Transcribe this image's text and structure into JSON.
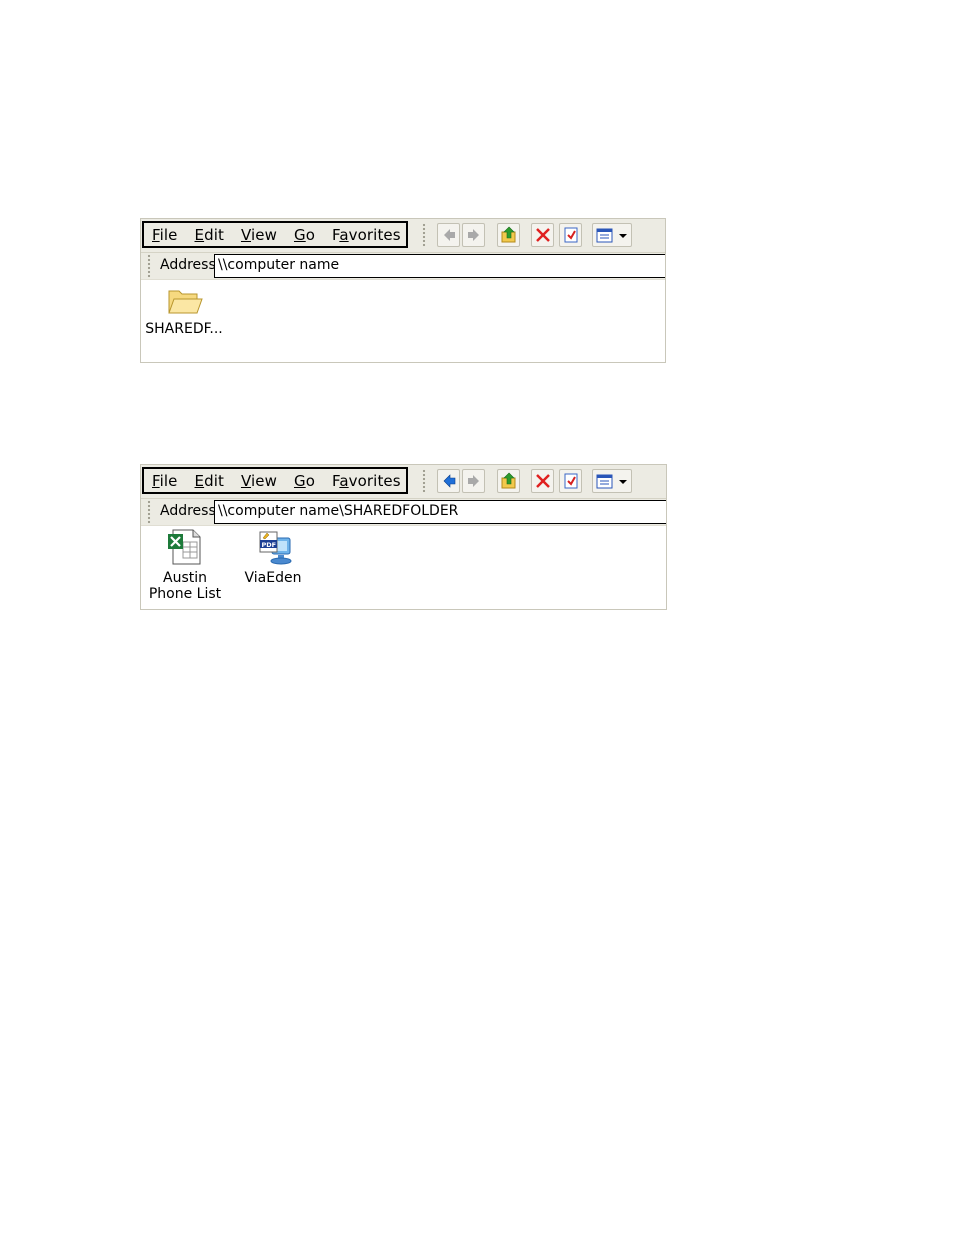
{
  "windows": [
    {
      "menu": {
        "file": {
          "u": "F",
          "rest": "ile"
        },
        "edit": {
          "u": "E",
          "rest": "dit"
        },
        "view": {
          "u": "V",
          "rest": "iew"
        },
        "go": {
          "u": "G",
          "rest": "o"
        },
        "favorites": {
          "pre": "F",
          "u": "a",
          "rest": "vorites"
        }
      },
      "address": {
        "label": "Address",
        "value": "\\\\computer name"
      },
      "items": [
        {
          "label": "SHAREDF...",
          "icon": "folder-icon"
        }
      ],
      "back_enabled": false
    },
    {
      "menu": {
        "file": {
          "u": "F",
          "rest": "ile"
        },
        "edit": {
          "u": "E",
          "rest": "dit"
        },
        "view": {
          "u": "V",
          "rest": "iew"
        },
        "go": {
          "u": "G",
          "rest": "o"
        },
        "favorites": {
          "pre": "F",
          "u": "a",
          "rest": "vorites"
        }
      },
      "address": {
        "label": "Address",
        "value": "\\\\computer name\\SHAREDFOLDER"
      },
      "items": [
        {
          "label_line1": "Austin",
          "label_line2": "Phone List",
          "icon": "excel-file-icon"
        },
        {
          "label": "ViaEden",
          "icon": "pdf-network-icon"
        }
      ],
      "back_enabled": true
    }
  ],
  "icons": {
    "back": "back-arrow-icon",
    "forward": "forward-arrow-icon",
    "up": "up-folder-icon",
    "stop": "stop-icon",
    "favorites": "favorites-check-icon",
    "views": "view-menu-icon"
  },
  "colors": {
    "toolbar_bg": "#ecebe3",
    "back_enabled": "#1f6fd8",
    "arrow_disabled": "#a9a9a9",
    "stop_red": "#e02020"
  }
}
